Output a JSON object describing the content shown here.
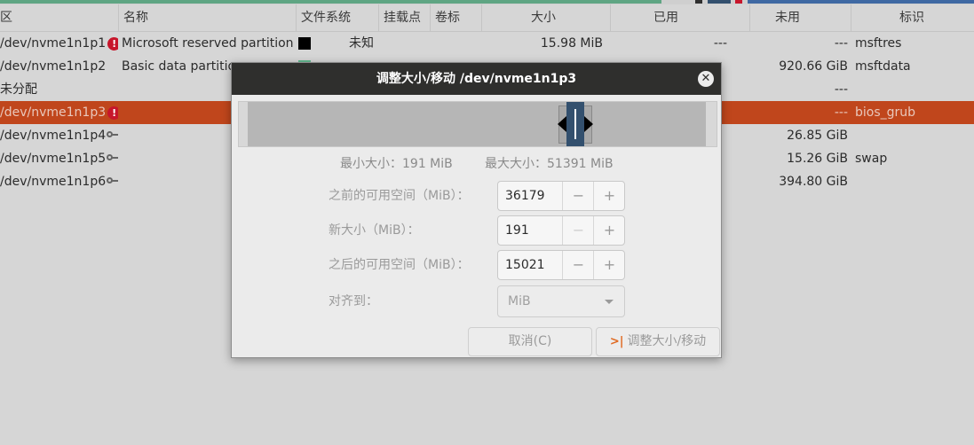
{
  "colors": {
    "selection": "#c0461c",
    "dialog_title_bg": "#2f2f2d",
    "warning": "#c7162b",
    "handle": "#33506e",
    "ntfs_swatch": "#63b98f",
    "resize_icon": "#e06a22"
  },
  "table": {
    "headers": [
      "区",
      "名称",
      "文件系统",
      "挂载点",
      "卷标",
      "大小",
      "已用",
      "未用",
      "标识"
    ],
    "rows": [
      {
        "partition": "/dev/nvme1n1p1",
        "icon": "warning-icon",
        "name": "Microsoft reserved partition",
        "filesystem": "未知",
        "label": "",
        "size": "15.98 MiB",
        "used": "---",
        "unused": "---",
        "flags": "msftres"
      },
      {
        "partition": "/dev/nvme1n1p2",
        "icon": "",
        "name": "Basic data partitio",
        "filesystem": "",
        "label": "",
        "size": "",
        "used": "",
        "unused": "920.66 GiB",
        "flags": "msftdata"
      },
      {
        "partition": "未分配",
        "icon": "",
        "name": "",
        "filesystem": "",
        "label": "",
        "size": "",
        "used": "",
        "unused": "---",
        "flags": ""
      },
      {
        "partition": "/dev/nvme1n1p3",
        "icon": "warning-icon",
        "name": "",
        "filesystem": "",
        "label": "",
        "size": "",
        "used": "",
        "unused": "---",
        "flags": "bios_grub"
      },
      {
        "partition": "/dev/nvme1n1p4",
        "icon": "key-icon",
        "name": "",
        "filesystem": "",
        "label": "",
        "size": "",
        "used": "",
        "unused": "26.85 GiB",
        "flags": ""
      },
      {
        "partition": "/dev/nvme1n1p5",
        "icon": "key-icon",
        "name": "",
        "filesystem": "",
        "label": "",
        "size": "",
        "used": "",
        "unused": "15.26 GiB",
        "flags": "swap"
      },
      {
        "partition": "/dev/nvme1n1p6",
        "icon": "key-icon",
        "name": "",
        "filesystem": "",
        "label": "",
        "size": "",
        "used": "",
        "unused": "394.80 GiB",
        "flags": ""
      }
    ],
    "selected_row": 3
  },
  "dialog": {
    "title": "调整大小/移动 /dev/nvme1n1p3",
    "min_size": "最小大小：191 MiB",
    "max_size": "最大大小：51391 MiB",
    "free_before_label": "之前的可用空间（MiB）：",
    "free_before_value": "36179",
    "new_size_label": "新大小（MiB）：",
    "new_size_value": "191",
    "free_after_label": "之后的可用空间（MiB）：",
    "free_after_value": "15021",
    "align_label": "对齐到：",
    "align_value": "MiB",
    "cancel_label": "取消(C)",
    "resize_label": "调整大小/移动",
    "minus": "−",
    "plus": "+"
  }
}
